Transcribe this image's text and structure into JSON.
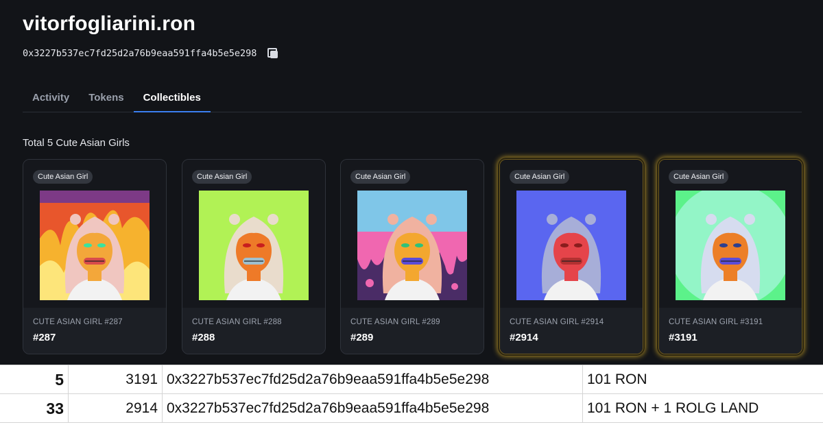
{
  "profile": {
    "name": "vitorfogliarini.ron",
    "address": "0x3227b537ec7fd25d2a76b9eaa591ffa4b5e5e298"
  },
  "tabs": [
    {
      "label": "Activity",
      "active": false
    },
    {
      "label": "Tokens",
      "active": false
    },
    {
      "label": "Collectibles",
      "active": true
    }
  ],
  "collection": {
    "total_label": "Total 5 Cute Asian Girls",
    "cards": [
      {
        "badge": "Cute Asian Girl",
        "name": "CUTE ASIAN GIRL #287",
        "id": "#287",
        "highlighted": false,
        "bg": "fire",
        "hair": "#f0c6c0",
        "skin": "#f3a73a",
        "eyes": "#39e3a0",
        "mouth": "#d84b4b",
        "bg_color": "#e8562c"
      },
      {
        "badge": "Cute Asian Girl",
        "name": "CUTE ASIAN GIRL #288",
        "id": "#288",
        "highlighted": false,
        "bg": "lime",
        "hair": "#e9dccc",
        "skin": "#ee7a28",
        "eyes": "#c81e1e",
        "mouth": "#9fc0cf",
        "bg_color": "#b1f255"
      },
      {
        "badge": "Cute Asian Girl",
        "name": "CUTE ASIAN GIRL #289",
        "id": "#289",
        "highlighted": false,
        "bg": "drip",
        "hair": "#f0b2a0",
        "skin": "#f3a72f",
        "eyes": "#2ec27a",
        "mouth": "#5b4cd8",
        "bg_color": "#4a2c66"
      },
      {
        "badge": "Cute Asian Girl",
        "name": "CUTE ASIAN GIRL #2914",
        "id": "#2914",
        "highlighted": true,
        "bg": "blue",
        "hair": "#a7aed8",
        "skin": "#e5444a",
        "eyes": "#8a1d1d",
        "mouth": "#b23131",
        "bg_color": "#5a66f0"
      },
      {
        "badge": "Cute Asian Girl",
        "name": "CUTE ASIAN GIRL #3191",
        "id": "#3191",
        "highlighted": true,
        "bg": "mint",
        "hair": "#d6dcef",
        "skin": "#ec7f28",
        "eyes": "#2d3f8f",
        "mouth": "#5b4cd8",
        "bg_color": "#5cf28a"
      }
    ]
  },
  "sheet": {
    "rows": [
      {
        "rank": "5",
        "token": "3191",
        "address": "0x3227b537ec7fd25d2a76b9eaa591ffa4b5e5e298",
        "prize": "101 RON"
      },
      {
        "rank": "33",
        "token": "2914",
        "address": "0x3227b537ec7fd25d2a76b9eaa591ffa4b5e5e298",
        "prize": "101 RON + 1 ROLG LAND"
      }
    ]
  }
}
